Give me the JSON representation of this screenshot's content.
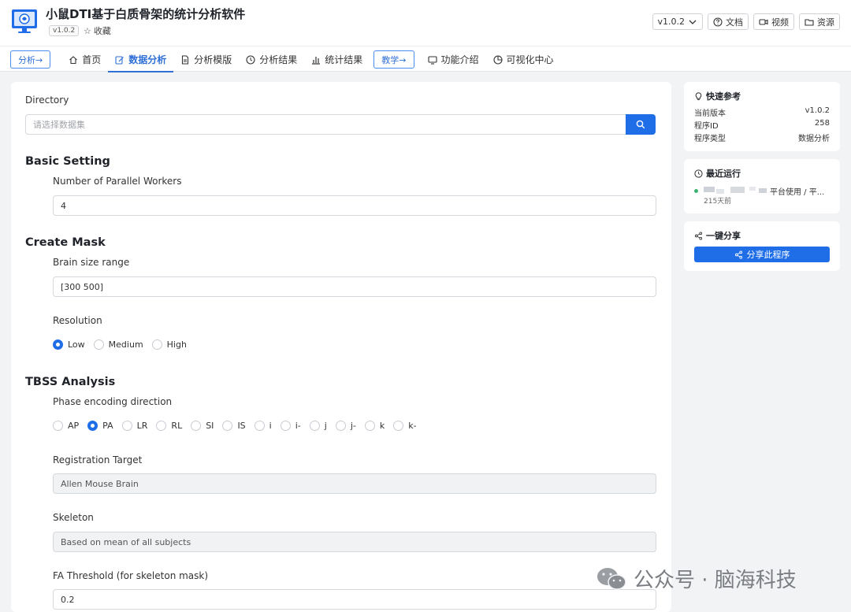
{
  "app": {
    "title": "小鼠DTI基于白质骨架的统计分析软件",
    "version_badge": "v1.0.2",
    "favorite_label": "收藏"
  },
  "header_actions": {
    "version_select": "v1.0.2",
    "docs": "文档",
    "video": "视频",
    "resources": "资源"
  },
  "nav": {
    "analysis_pill": "分析→",
    "teach_pill": "教学→",
    "items": [
      "首页",
      "数据分析",
      "分析模版",
      "分析结果",
      "统计结果",
      "功能介绍",
      "可视化中心"
    ],
    "active": "数据分析"
  },
  "form": {
    "directory_label": "Directory",
    "directory_placeholder": "请选择数据集",
    "basic_setting": "Basic Setting",
    "workers_label": "Number of Parallel Workers",
    "workers_value": "4",
    "create_mask": "Create Mask",
    "brain_size_label": "Brain size range",
    "brain_size_value": "[300 500]",
    "resolution_label": "Resolution",
    "resolution_options": [
      "Low",
      "Medium",
      "High"
    ],
    "resolution_selected": "Low",
    "tbss": "TBSS Analysis",
    "phase_label": "Phase encoding direction",
    "phase_options": [
      "AP",
      "PA",
      "LR",
      "RL",
      "SI",
      "IS",
      "i",
      "i-",
      "j",
      "j-",
      "k",
      "k-"
    ],
    "phase_selected": "PA",
    "reg_target_label": "Registration Target",
    "reg_target_value": "Allen Mouse Brain",
    "skeleton_label": "Skeleton",
    "skeleton_value": "Based on mean of all subjects",
    "fa_label": "FA Threshold (for skeleton mask)",
    "fa_value": "0.2"
  },
  "sidebar": {
    "quick_ref_title": "快速参考",
    "quick_ref": [
      {
        "k": "当前版本",
        "v": "v1.0.2"
      },
      {
        "k": "程序ID",
        "v": "258"
      },
      {
        "k": "程序类型",
        "v": "数据分析"
      }
    ],
    "recent_title": "最近运行",
    "recent_text": "平台使用 / 平...",
    "recent_time": "215天前",
    "share_title": "一键分享",
    "share_button": "分享此程序"
  },
  "watermark": "公众号 · 脑海科技",
  "colors": {
    "accent": "#1f6ee8",
    "status_dot": "#3cb371"
  }
}
